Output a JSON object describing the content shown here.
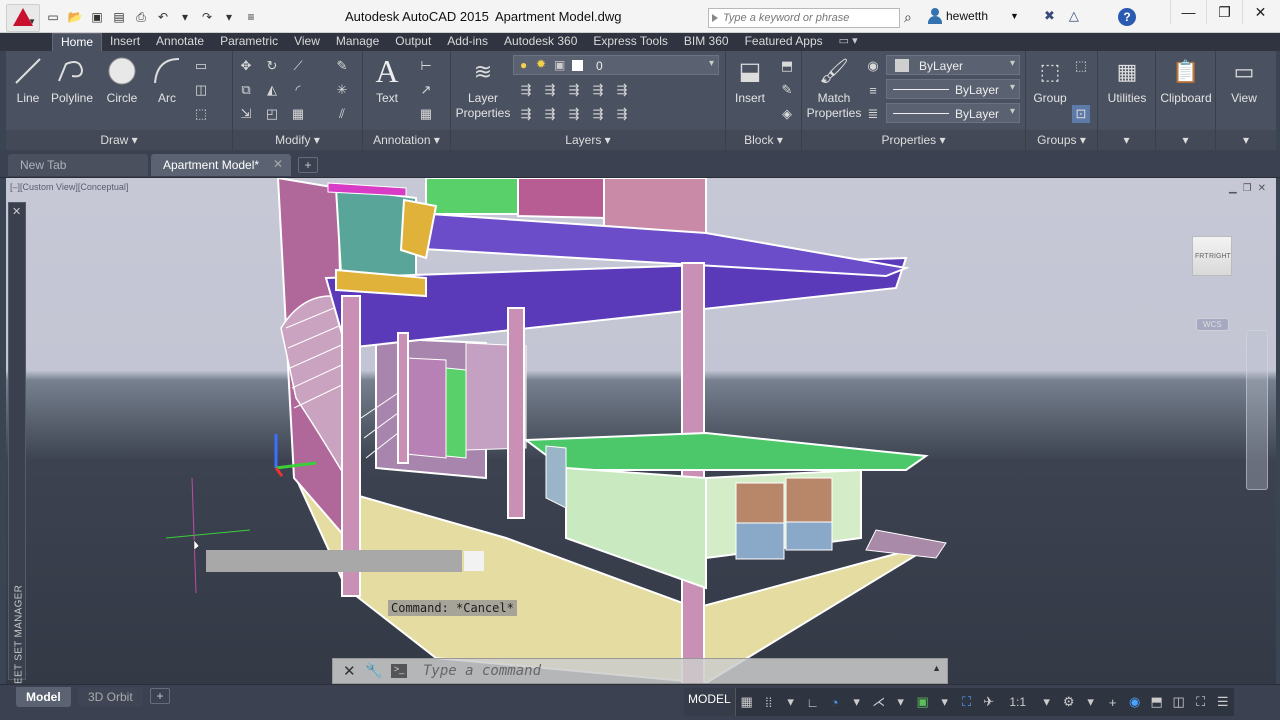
{
  "titlebar": {
    "app_name": "Autodesk AutoCAD 2015",
    "filename": "Apartment Model.dwg",
    "search_placeholder": "Type a keyword or phrase",
    "username": "hewetth"
  },
  "ribbon_tabs": [
    "Home",
    "Insert",
    "Annotate",
    "Parametric",
    "View",
    "Manage",
    "Output",
    "Add-ins",
    "Autodesk 360",
    "Express Tools",
    "BIM 360",
    "Featured Apps"
  ],
  "ribbon": {
    "draw": {
      "title": "Draw",
      "line": "Line",
      "polyline": "Polyline",
      "circle": "Circle",
      "arc": "Arc"
    },
    "modify": {
      "title": "Modify"
    },
    "annotation": {
      "title": "Annotation",
      "text": "Text"
    },
    "layers": {
      "title": "Layers",
      "layer_properties": "Layer Properties",
      "current_layer": "0"
    },
    "block": {
      "title": "Block",
      "insert": "Insert"
    },
    "properties": {
      "title": "Properties",
      "match_properties": "Match Properties",
      "color": "ByLayer",
      "linetype": "ByLayer",
      "lineweight": "ByLayer"
    },
    "groups": {
      "title": "Groups",
      "group": "Group"
    },
    "utilities": "Utilities",
    "clipboard": "Clipboard",
    "view": "View"
  },
  "file_tabs": {
    "new_tab": "New Tab",
    "model_tab": "Apartment Model*"
  },
  "viewport": {
    "label": "[–][Custom View][Conceptual]",
    "viewcube_front": "FRT",
    "viewcube_right": "RIGHT",
    "wcs": "WCS",
    "sheet_set_manager": "SHEET SET MANAGER",
    "command_history": "Command: *Cancel*",
    "command_placeholder": "Type a command"
  },
  "statusbar": {
    "layout_tabs": [
      "Model",
      "3D Orbit"
    ],
    "model_label": "MODEL",
    "scale": "1:1"
  }
}
